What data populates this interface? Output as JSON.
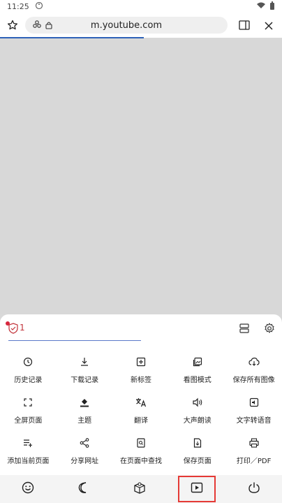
{
  "status": {
    "time": "11:25"
  },
  "browser": {
    "url": "m.youtube.com",
    "progress_percent": 51
  },
  "sheet": {
    "blocked_count": "1",
    "items": [
      {
        "label": "历史记录",
        "icon": "history-icon"
      },
      {
        "label": "下载记录",
        "icon": "download-icon"
      },
      {
        "label": "新标签",
        "icon": "new-tab-icon"
      },
      {
        "label": "看图模式",
        "icon": "image-mode-icon"
      },
      {
        "label": "保存所有图像",
        "icon": "cloud-download-icon"
      },
      {
        "label": "全屏页面",
        "icon": "fullscreen-icon"
      },
      {
        "label": "主题",
        "icon": "paint-bucket-icon"
      },
      {
        "label": "翻译",
        "icon": "translate-icon"
      },
      {
        "label": "大声朗读",
        "icon": "read-aloud-icon"
      },
      {
        "label": "文字转语音",
        "icon": "text-to-speech-icon"
      },
      {
        "label": "添加当前页面",
        "icon": "add-to-list-icon"
      },
      {
        "label": "分享网址",
        "icon": "share-icon"
      },
      {
        "label": "在页面中查找",
        "icon": "find-in-page-icon"
      },
      {
        "label": "保存页面",
        "icon": "save-page-icon"
      },
      {
        "label": "打印／PDF",
        "icon": "print-icon"
      }
    ]
  },
  "toolbar": {
    "buttons": [
      {
        "icon": "emoji-icon"
      },
      {
        "icon": "night-mode-icon"
      },
      {
        "icon": "map-package-icon"
      },
      {
        "icon": "video-player-icon",
        "highlighted": true
      },
      {
        "icon": "power-icon"
      }
    ]
  },
  "colors": {
    "accent": "#2e62b9",
    "badge_red": "#d7263d",
    "highlight_border": "#e53935"
  }
}
